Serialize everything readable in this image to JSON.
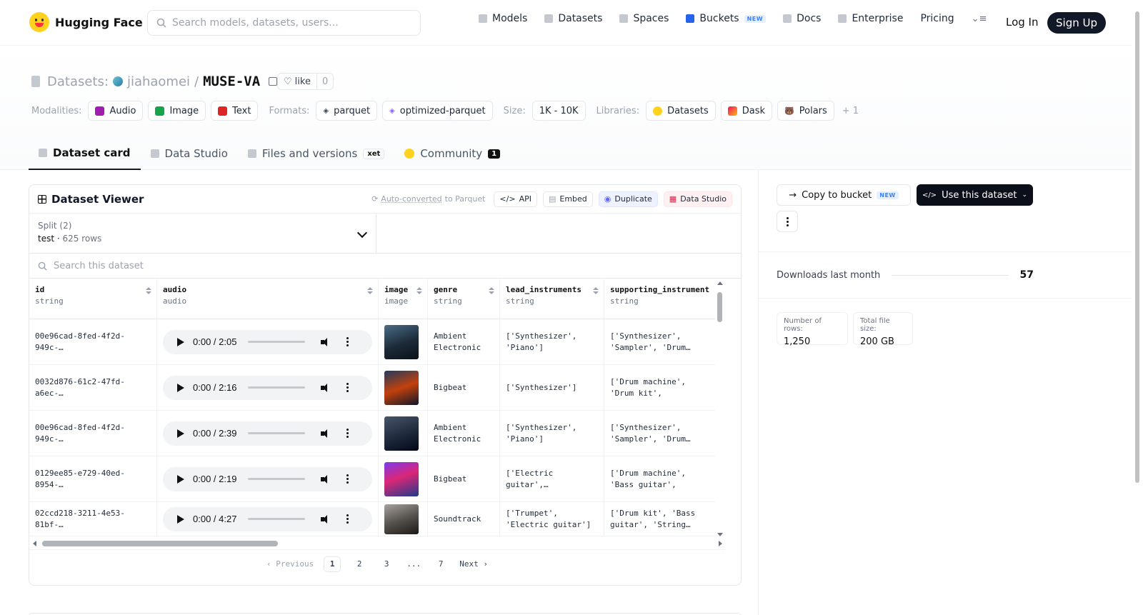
{
  "nav": {
    "brand": "Hugging Face",
    "search_placeholder": "Search models, datasets, users...",
    "links": [
      {
        "label": "Models",
        "icon": "cube-icon"
      },
      {
        "label": "Datasets",
        "icon": "database-icon"
      },
      {
        "label": "Spaces",
        "icon": "grid-icon"
      },
      {
        "label": "Buckets",
        "icon": "bucket-icon",
        "badge": "NEW"
      },
      {
        "label": "Docs",
        "icon": "book-icon"
      },
      {
        "label": "Enterprise",
        "icon": "enterprise-icon"
      },
      {
        "label": "Pricing"
      }
    ],
    "login": "Log In",
    "signup": "Sign Up"
  },
  "repo": {
    "type_label": "Datasets:",
    "owner": "jiahaomei",
    "separator": "/",
    "name": "MUSE-VA",
    "like_label": "like",
    "like_count": "0"
  },
  "tags": {
    "modalities_label": "Modalities:",
    "modalities": [
      {
        "label": "Audio",
        "color": "#a21caf"
      },
      {
        "label": "Image",
        "color": "#16a34a"
      },
      {
        "label": "Text",
        "color": "#dc2626"
      }
    ],
    "formats_label": "Formats:",
    "formats": [
      "parquet",
      "optimized-parquet"
    ],
    "size_label": "Size:",
    "size": "1K - 10K",
    "libraries_label": "Libraries:",
    "libraries": [
      "Datasets",
      "Dask",
      "Polars"
    ],
    "more": "+ 1"
  },
  "tabs": {
    "dataset_card": "Dataset card",
    "data_studio": "Data Studio",
    "files": "Files and versions",
    "xet": "xet",
    "community": "Community",
    "community_count": "1"
  },
  "viewer": {
    "title": "Dataset Viewer",
    "auto_converted": "Auto-converted",
    "to_parquet": "to Parquet",
    "api": "API",
    "embed": "Embed",
    "duplicate": "Duplicate",
    "data_studio": "Data Studio",
    "split_label": "Split (2)",
    "split_value": "test",
    "split_rows": "625 rows",
    "search_placeholder": "Search this dataset",
    "columns": [
      {
        "name": "id",
        "type": "string"
      },
      {
        "name": "audio",
        "type": "audio"
      },
      {
        "name": "image",
        "type": "image"
      },
      {
        "name": "genre",
        "type": "string"
      },
      {
        "name": "lead_instruments",
        "type": "string"
      },
      {
        "name": "supporting_instrument",
        "type": "string"
      }
    ],
    "rows": [
      {
        "id": "00e96cad-8fed-4f2d-949c-…",
        "time": "0:00 / 2:05",
        "genre": "Ambient Electronic",
        "lead": "['Synthesizer', 'Piano']",
        "support": "['Synthesizer', 'Sampler', 'Drum…"
      },
      {
        "id": "0032d876-61c2-47fd-a6ec-…",
        "time": "0:00 / 2:16",
        "genre": "Bigbeat",
        "lead": "['Synthesizer']",
        "support": "['Drum machine', 'Drum kit', 'Synthesizer',…"
      },
      {
        "id": "00e96cad-8fed-4f2d-949c-…",
        "time": "0:00 / 2:39",
        "genre": "Ambient Electronic",
        "lead": "['Synthesizer', 'Piano']",
        "support": "['Synthesizer', 'Sampler', 'Drum…"
      },
      {
        "id": "0129ee85-e729-40ed-8954-…",
        "time": "0:00 / 2:19",
        "genre": "Bigbeat",
        "lead": "['Electric guitar',…",
        "support": "['Drum machine', 'Bass guitar', 'Sampler']"
      },
      {
        "id": "02ccd218-3211-4e53-81bf-…",
        "time": "0:00 / 4:27",
        "genre": "Soundtrack",
        "lead": "['Trumpet', 'Electric guitar']",
        "support": "['Drum kit', 'Bass guitar', 'String…"
      }
    ],
    "pager": {
      "prev": "Previous",
      "pages": [
        "1",
        "2",
        "3",
        "...",
        "7"
      ],
      "next": "Next"
    }
  },
  "sidebar": {
    "copy_to_bucket": "Copy to bucket",
    "copy_badge": "NEW",
    "use_dataset": "Use this dataset",
    "downloads_label": "Downloads last month",
    "downloads_value": "57",
    "rows_label": "Number of rows:",
    "rows_value": "1,250",
    "size_label": "Total file size:",
    "size_value": "200 GB"
  }
}
